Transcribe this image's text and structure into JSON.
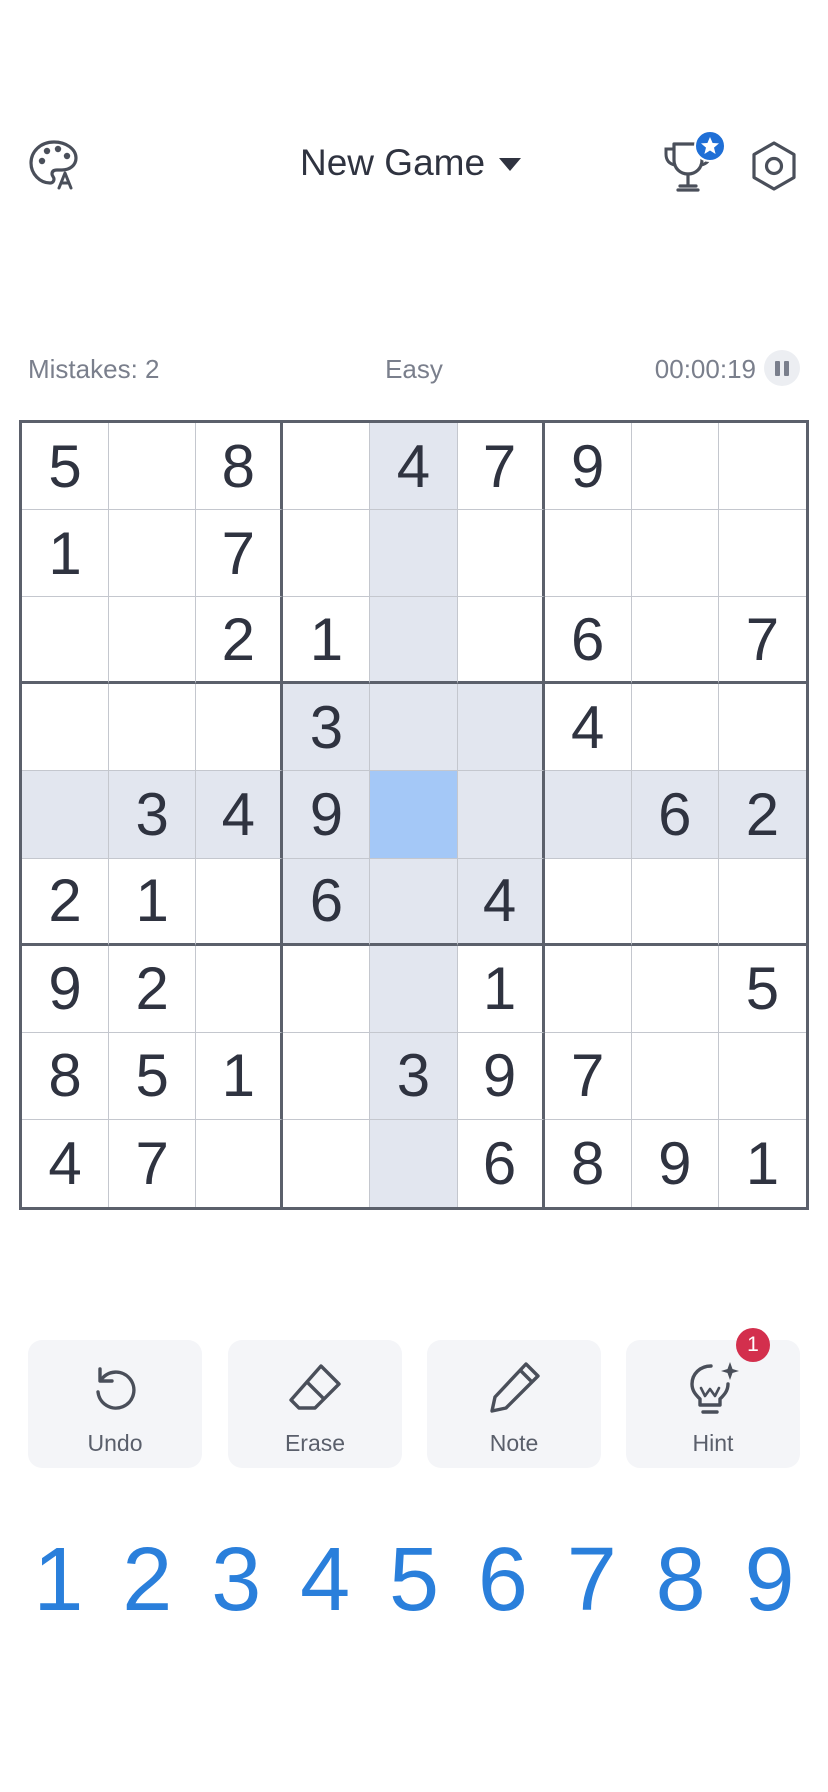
{
  "header": {
    "title": "New Game",
    "theme_icon": "palette-icon",
    "trophy_icon": "trophy-icon",
    "settings_icon": "hexagon-settings-icon"
  },
  "status": {
    "mistakes": "Mistakes: 2",
    "difficulty": "Easy",
    "timer": "00:00:19"
  },
  "board": {
    "rows": [
      [
        "5",
        "",
        "8",
        "",
        "4",
        "7",
        "9",
        "",
        ""
      ],
      [
        "1",
        "",
        "7",
        "",
        "",
        "",
        "",
        "",
        ""
      ],
      [
        "",
        "",
        "2",
        "1",
        "",
        "",
        "6",
        "",
        "7"
      ],
      [
        "",
        "",
        "",
        "3",
        "",
        "",
        "4",
        "",
        ""
      ],
      [
        "",
        "3",
        "4",
        "9",
        "",
        "",
        "",
        "6",
        "2"
      ],
      [
        "2",
        "1",
        "",
        "6",
        "",
        "4",
        "",
        "",
        ""
      ],
      [
        "9",
        "2",
        "",
        "",
        "",
        "1",
        "",
        "",
        "5"
      ],
      [
        "8",
        "5",
        "1",
        "",
        "3",
        "9",
        "7",
        "",
        ""
      ],
      [
        "4",
        "7",
        "",
        "",
        "",
        "6",
        "8",
        "9",
        "1"
      ]
    ],
    "selected": [
      4,
      4
    ]
  },
  "actions": {
    "undo": "Undo",
    "erase": "Erase",
    "note": "Note",
    "hint": "Hint",
    "hint_badge": "1"
  },
  "numpad": [
    "1",
    "2",
    "3",
    "4",
    "5",
    "6",
    "7",
    "8",
    "9"
  ],
  "colors": {
    "accent": "#2a7fdb",
    "selected_cell": "#a4c8f7",
    "highlight_cell": "#e2e6ef",
    "badge": "#d32f4d",
    "trophy_star": "#1f6fd6"
  }
}
